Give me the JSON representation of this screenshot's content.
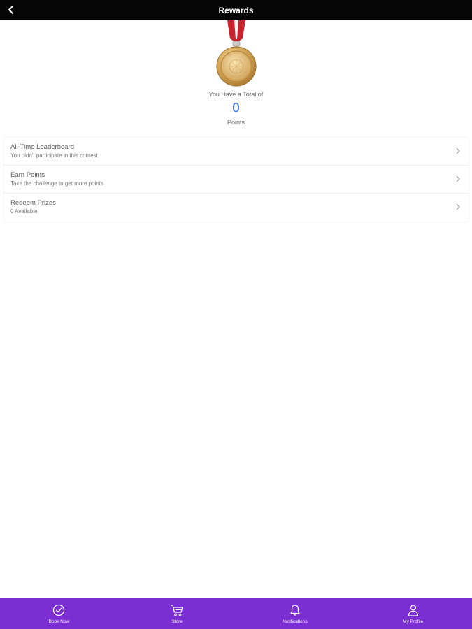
{
  "header": {
    "title": "Rewards",
    "back_icon": "chevron-left-icon"
  },
  "rewards": {
    "medal_icon": "gold-medal-icon",
    "total_label": "You Have a Total of",
    "points_value": "0",
    "points_label": "Points"
  },
  "list": {
    "items": [
      {
        "title": "All-Time Leaderboard",
        "subtitle": "You didn't participate in this contest.",
        "icon": "chevron-right-icon"
      },
      {
        "title": "Earn Points",
        "subtitle": "Take the challenge to get more points",
        "icon": "chevron-right-icon"
      },
      {
        "title": "Redeem Prizes",
        "subtitle": "0 Available",
        "icon": "chevron-right-icon"
      }
    ]
  },
  "bottom_nav": {
    "items": [
      {
        "label": "Book Now",
        "icon": "check-circle-icon"
      },
      {
        "label": "Store",
        "icon": "cart-icon"
      },
      {
        "label": "Notifications",
        "icon": "bell-icon"
      },
      {
        "label": "My Profile",
        "icon": "user-icon"
      }
    ]
  },
  "colors": {
    "header_bg": "#050505",
    "nav_bg": "#7b2fd3",
    "points_accent": "#3b7be0",
    "ribbon": "#c8222c",
    "medal_gold": "#d4a657"
  }
}
